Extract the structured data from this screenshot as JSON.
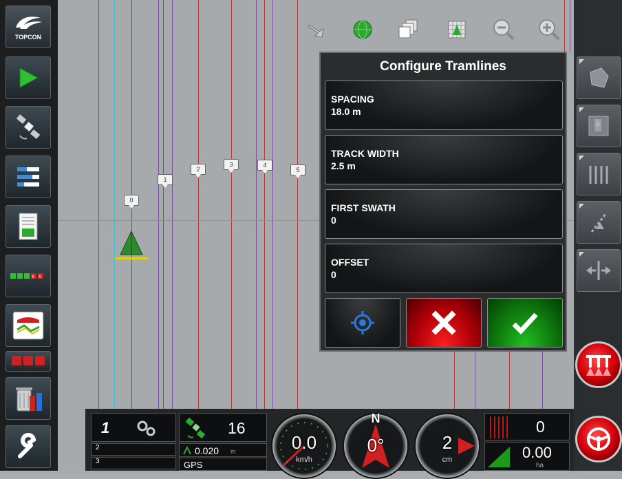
{
  "brand": {
    "logo_text": "TOPCON"
  },
  "map": {
    "swath_markers": [
      "0",
      "1",
      "2",
      "3",
      "4",
      "5"
    ]
  },
  "dialog": {
    "title": "Configure Tramlines",
    "fields": [
      {
        "label": "SPACING",
        "value": "18.0 m"
      },
      {
        "label": "TRACK WIDTH",
        "value": "2.5 m"
      },
      {
        "label": "FIRST SWATH",
        "value": "0"
      },
      {
        "label": "OFFSET",
        "value": "0"
      }
    ]
  },
  "status": {
    "profile_number": "1",
    "row2": "2",
    "row3": "3",
    "satellites": "16",
    "accuracy": "0.020",
    "accuracy_unit": "m",
    "gps_label": "GPS",
    "speed": "0.0",
    "speed_unit": "km/h",
    "heading_compass": "N",
    "heading": "0°",
    "cross_track": "2",
    "cross_track_unit": "cm",
    "sections_count": "0",
    "area": "0.00",
    "area_unit": "ha"
  },
  "colors": {
    "accent_green": "#2fa82f",
    "cancel_red": "#d0000a",
    "confirm_green": "#1c8f1c",
    "guide_line_red": "#b83a3a",
    "guide_line_purple": "#7b4fa0",
    "guide_line_cyan": "#37c3d4"
  },
  "icons": {
    "left_bar": [
      "topcon-logo",
      "navigation-arrow-icon",
      "satellite-icon",
      "list-menu-icon",
      "report-document-icon",
      "section-control-icon",
      "field-implement-icon",
      "red-sections-icon",
      "trash-usb-icon",
      "wrench-icon"
    ],
    "top_bar": [
      "hand-pointer-icon",
      "globe-icon",
      "layers-icon",
      "grid-map-icon",
      "zoom-out-icon",
      "zoom-in-icon"
    ],
    "right_bar": [
      "field-boundary-icon",
      "tramline-map-icon",
      "parallel-lines-icon",
      "curve-guidance-icon",
      "shift-line-icon"
    ]
  }
}
